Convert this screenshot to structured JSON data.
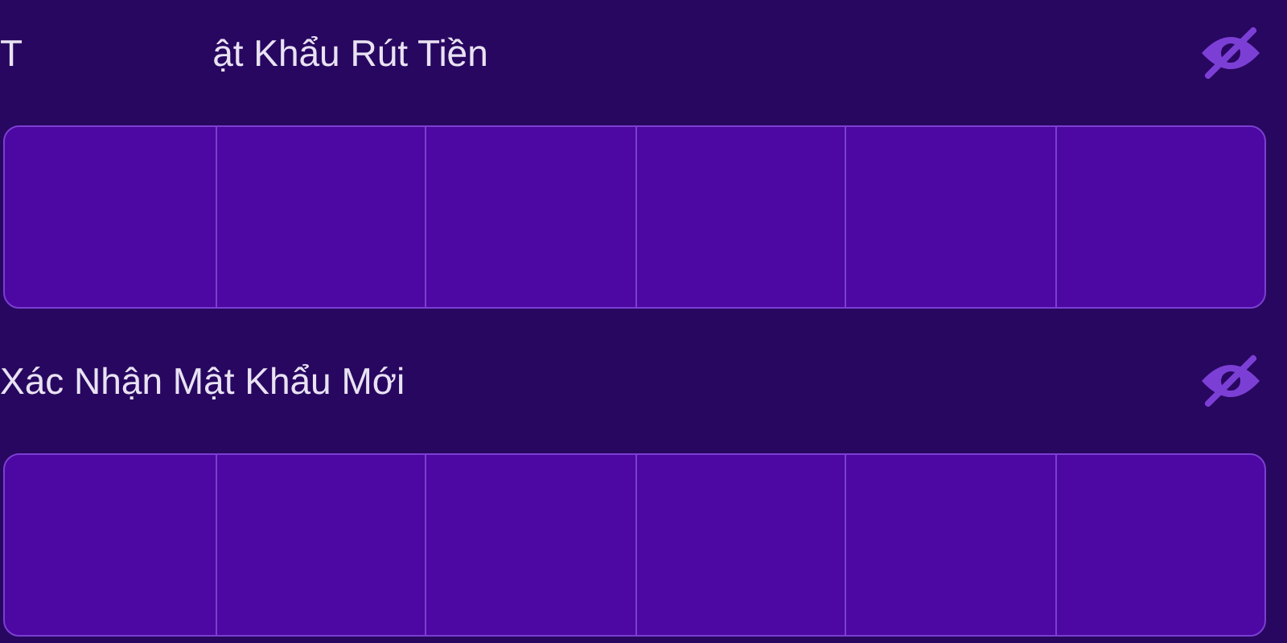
{
  "fields": [
    {
      "label_parts": [
        "T",
        "ật Khẩu Rút Tiền"
      ],
      "visible": false,
      "cells": [
        {
          "filled": false
        },
        {
          "filled": false
        },
        {
          "filled": false
        },
        {
          "filled": false
        },
        {
          "filled": false
        },
        {
          "filled": false
        }
      ]
    },
    {
      "label_parts": [
        "Xác Nhận Mật Khẩu Mới"
      ],
      "visible": false,
      "cells": [
        {
          "filled": false
        },
        {
          "filled": false
        },
        {
          "filled": false
        },
        {
          "filled": false
        },
        {
          "filled": false
        },
        {
          "filled": false
        }
      ]
    }
  ]
}
